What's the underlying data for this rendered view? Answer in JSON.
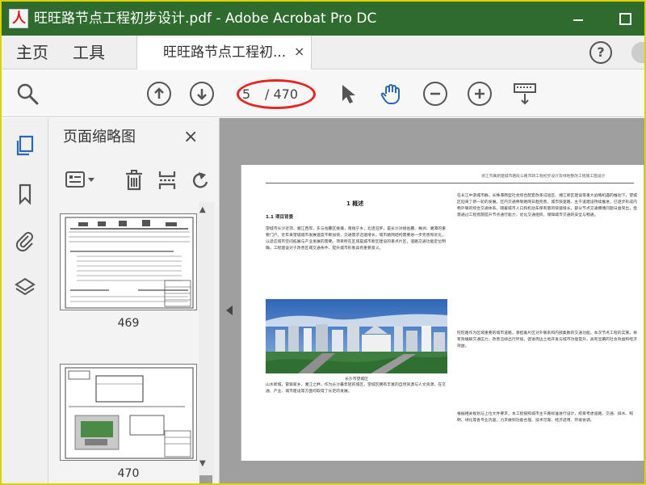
{
  "window": {
    "title": "旺旺路节点工程初步设计.pdf - Adobe Acrobat Pro DC",
    "app_logo_text": "人",
    "colors": {
      "title_bar": "#2f6b2f",
      "outer_border": "#d9d400",
      "annotation": "#e52521",
      "document_background": "#9f9f9f"
    }
  },
  "tabs": {
    "home": "主页",
    "tools": "工具",
    "document": "旺旺路节点工程初...",
    "close": "×",
    "help": "?"
  },
  "toolbar": {
    "icons": [
      "search-zoom-icon",
      "previous-page-icon",
      "next-page-icon",
      "select-pointer-icon",
      "hand-tool-icon",
      "zoom-out-icon",
      "zoom-in-icon",
      "more-tools-icon"
    ],
    "page_current": "5",
    "page_total": "/ 470"
  },
  "rail": {
    "items": [
      "pages-icon",
      "bookmark-icon",
      "attachment-icon",
      "layers-icon"
    ]
  },
  "thumbnail_panel": {
    "title": "页面缩略图",
    "close": "×",
    "tools": [
      "thumbnail-options-icon",
      "delete-icon",
      "insert-page-icon",
      "undo-icon"
    ],
    "thumbnails": [
      {
        "page": "469"
      },
      {
        "page": "470"
      }
    ]
  },
  "document": {
    "running_header": "浙江市属新建城市路段公路市政工程初步设计及绿地整改工程施工图设计",
    "section_title": "1 概述",
    "subsection_title": "1.1 项目背景",
    "left_paragraph_1": "望城市长沙近郊，湘江西岸，东与岳麓区接壤，南接宁乡，北连汨罗，是长沙对接岳麓、株洲、湘潭的重要门户。近年来望城城市发展速度不断加快，交通需求迅速增长，城市路网结构需要进一步完善和优化，以适应城市空间拓展与产业发展的需要。项目所在区域是城市新区建设的重点片区，道路交通功能定位明确，工程建设对于改善区域交通条件、提升城市形象具有重要意义。",
    "photo_caption": "长沙市望城区",
    "left_paragraph_2": "山水新城，雷锋家乡，湘江之畔。作为长沙最年轻的城区，望城区拥有丰富的自然资源与人文资源，在交通、产业、城市建设等方面均取得了长足的发展。",
    "right_paragraph_1": "在长江中游城市群、长株潭两型社会综合配套改革试验区、湘江新区建设等重大战略机遇的推动下，望城区迎来了新一轮的发展。区内交通骨架路网日趋完善，城市快速路、主干道建设持续推进，已逐步形成内畅外联的综合交通体系。随着城市人口和机动车保有量的快速增长，部分节点交通拥堵问题日益突出，亟需通过工程措施提升节点通行能力，优化交通组织，保障城市交通的安全与畅通。",
    "right_paragraph_2": "旺旺路作为区域重要的城市道路，承担着片区对外联系和内部集散的交通功能。本次节点工程的实施，将有效缓解交通压力，改善沿线出行环境，促进周边土地开发与城市功能提升，具有显著的社会效益和经济效益。",
    "right_paragraph_3": "根据相关规划与上位文件要求，本工程按照城市主干路标准进行设计，统筹考虑道路、交通、排水、照明、绿化等各专业内容，力求做到功能合理、技术可靠、经济适用、环境协调。"
  }
}
